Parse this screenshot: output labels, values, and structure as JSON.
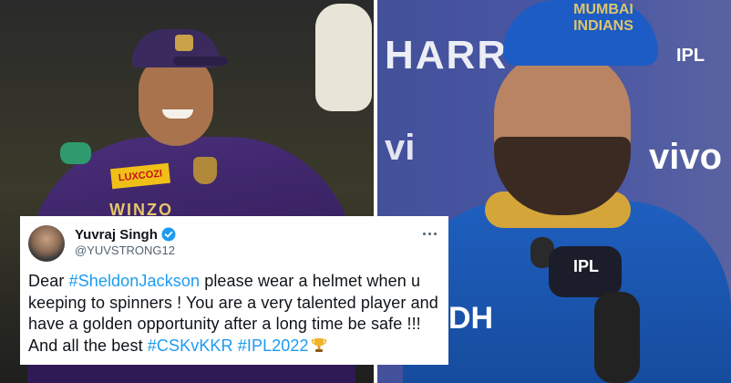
{
  "tweet": {
    "display_name": "Yuvraj Singh",
    "handle": "@YUVSTRONG12",
    "text_parts": {
      "p1": "Dear ",
      "tag1": "#SheldonJackson",
      "p2": " please wear a helmet when u keeping to spinners ! You are a very talented player and have a golden opportunity after a long time be safe !!! And all the best ",
      "tag2": "#CSKvKKR",
      "p3": " ",
      "tag3": "#IPL2022"
    },
    "verified_icon": "verified-badge-icon",
    "more_icon": "more-options-icon",
    "emoji_icon": "trophy-icon"
  },
  "left_photo": {
    "sponsor_text": "LUXCOZI",
    "chest_text": "WINZO"
  },
  "right_photo": {
    "sponsor_text": "HARR",
    "sponsor_text2": "vi",
    "tag_text": "IPL",
    "cap_text": "MUMBAI INDIANS",
    "mic_label": "IPL",
    "chest_text": "DH",
    "vivo_text": "vivo"
  },
  "colors": {
    "hashtag": "#1d9bf0",
    "verified": "#1d9bf0",
    "kkr_purple": "#3a2a5e",
    "mi_blue": "#1d5cc4"
  }
}
